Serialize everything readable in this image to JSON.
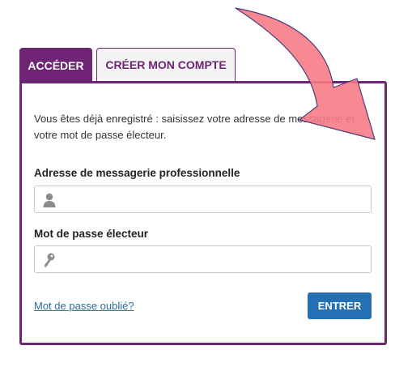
{
  "tabs": {
    "login_label": "ACCÉDER",
    "register_label": "CRÉER MON COMPTE"
  },
  "form": {
    "intro": "Vous êtes déjà enregistré : saisissez votre adresse de messagerie et votre mot de passe électeur.",
    "email_label": "Adresse de messagerie professionnelle",
    "email_value": "",
    "password_label": "Mot de passe électeur",
    "password_value": "",
    "forgot_link": "Mot de passe oublié?",
    "submit_label": "ENTRER"
  },
  "icons": {
    "email_field": "user-icon",
    "password_field": "key-icon",
    "annotation": "curved-arrow"
  },
  "colors": {
    "brand_purple": "#6f2475",
    "button_blue": "#2470b3",
    "link_blue": "#2a6ea8",
    "arrow_pink": "#f77b86"
  }
}
